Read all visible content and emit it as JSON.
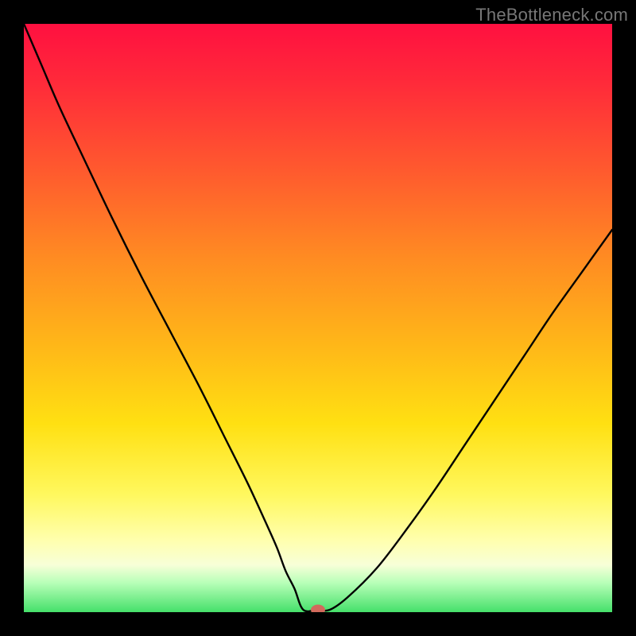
{
  "watermark": "TheBottleneck.com",
  "colors": {
    "background": "#000000",
    "curve": "#000000",
    "marker_fill": "#d26a5c",
    "marker_stroke": "#000000"
  },
  "chart_data": {
    "type": "line",
    "title": "",
    "xlabel": "",
    "ylabel": "",
    "xlim": [
      0,
      100
    ],
    "ylim": [
      0,
      100
    ],
    "grid": false,
    "legend": false,
    "series": [
      {
        "name": "curve",
        "x": [
          0,
          3,
          6,
          10,
          15,
          20,
          25,
          30,
          34,
          38,
          41,
          43,
          44.5,
          46,
          47.5,
          50,
          52,
          55,
          60,
          65,
          70,
          75,
          80,
          85,
          90,
          95,
          100
        ],
        "y": [
          100,
          93,
          86,
          77.5,
          67,
          57,
          47.5,
          38,
          30,
          22,
          15.5,
          11,
          7,
          4,
          2,
          0.4,
          0.4,
          2.5,
          7.5,
          14,
          21,
          28.5,
          36,
          43.5,
          51,
          58,
          65
        ]
      }
    ],
    "flat_bottom": {
      "x_start": 46.5,
      "x_end": 51.5,
      "y": 0.4
    },
    "marker": {
      "x": 50,
      "y": 0.4
    }
  }
}
